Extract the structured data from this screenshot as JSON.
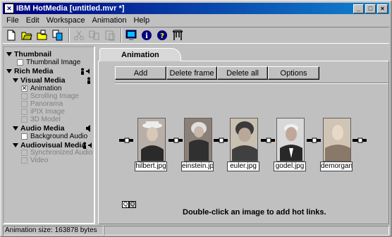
{
  "window": {
    "title": "IBM HotMedia [untitled.mvr *]"
  },
  "menu": [
    "File",
    "Edit",
    "Workspace",
    "Animation",
    "Help"
  ],
  "toolbar": {
    "buttons": [
      "new-file-icon",
      "open-folder-icon",
      "open-project-icon",
      "copy-icon",
      "cut-icon",
      "duplicate-icon",
      "paste-icon",
      "monitor-icon",
      "info-icon",
      "help-icon",
      "gate-icon"
    ]
  },
  "tree": {
    "thumbnail": "Thumbnail",
    "thumbnail_image": "Thumbnail Image",
    "rich_media": "Rich Media",
    "visual_media": "Visual Media",
    "animation": "Animation",
    "scrolling_image": "Scrolling Image",
    "panorama": "Panorama",
    "ipix_image": "iPIX Image",
    "model_3d": "3D Model",
    "audio_media": "Audio Media",
    "background_audio": "Background Audio",
    "audiovisual_media": "Audiovisual Media",
    "synchronized_audio": "Synchronized Audio",
    "video": "Video"
  },
  "tab": {
    "label": "Animation"
  },
  "buttons": {
    "add": "Add",
    "delete_frame": "Delete frame",
    "delete_all": "Delete all",
    "options": "Options"
  },
  "frames": [
    {
      "name": "hilbert.jpg"
    },
    {
      "name": "einstein.jp"
    },
    {
      "name": "euler.jpg"
    },
    {
      "name": "godel.jpg"
    },
    {
      "name": "demorgan"
    }
  ],
  "hint": "Double-click an image to add hot links.",
  "status": {
    "text": "Animation size: 163878 bytes"
  },
  "colors": {
    "title_bar": "#000080",
    "face": "#c0c0c0"
  }
}
